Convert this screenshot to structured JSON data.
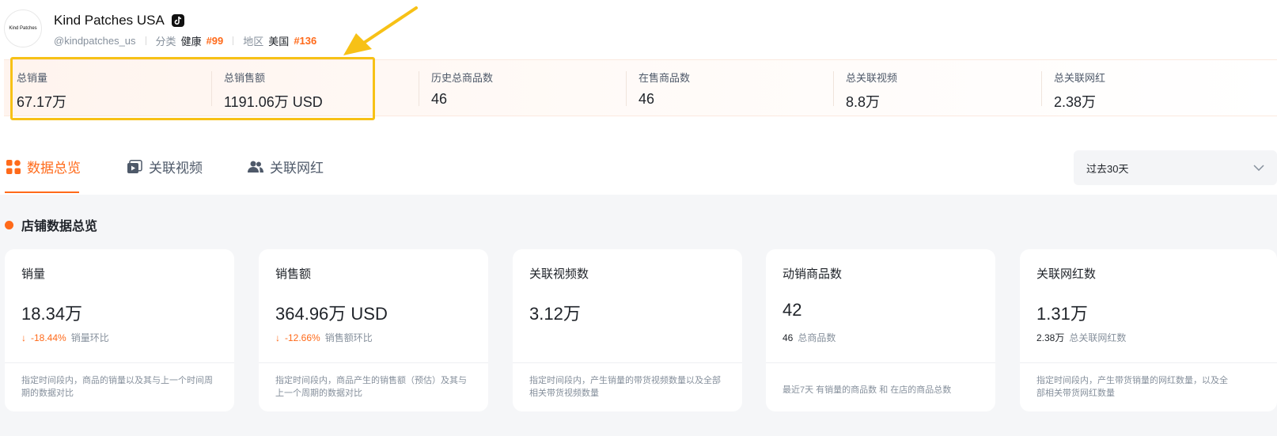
{
  "shop": {
    "logo_text": "Kind Patches",
    "name": "Kind Patches USA",
    "handle": "@kindpatches_us",
    "category_key": "分类",
    "category_value": "健康",
    "category_rank": "#99",
    "region_key": "地区",
    "region_value": "美国",
    "region_rank": "#136"
  },
  "stats": [
    {
      "label": "总销量",
      "value": "67.17万"
    },
    {
      "label": "总销售额",
      "value": "1191.06万 USD"
    },
    {
      "label": "历史总商品数",
      "value": "46"
    },
    {
      "label": "在售商品数",
      "value": "46"
    },
    {
      "label": "总关联视频",
      "value": "8.8万"
    },
    {
      "label": "总关联网红",
      "value": "2.38万"
    }
  ],
  "tabs": [
    {
      "label": "数据总览",
      "icon": "grid-icon"
    },
    {
      "label": "关联视频",
      "icon": "video-icon"
    },
    {
      "label": "关联网红",
      "icon": "users-icon"
    }
  ],
  "period_select": {
    "value": "过去30天"
  },
  "overview": {
    "title": "店铺数据总览",
    "cards": [
      {
        "title": "销量",
        "value": "18.34万",
        "change": "-18.44%",
        "change_label": "销量环比",
        "desc": "指定时间段内，商品的销量以及其与上一个时间周期的数据对比"
      },
      {
        "title": "销售额",
        "value": "364.96万 USD",
        "change": "-12.66%",
        "change_label": "销售额环比",
        "desc": "指定时间段内，商品产生的销售额（预估）及其与上一个周期的数据对比"
      },
      {
        "title": "关联视频数",
        "value": "3.12万",
        "desc": "指定时间段内，产生销量的带货视频数量以及全部相关带货视频数量"
      },
      {
        "title": "动销商品数",
        "value": "42",
        "sub_value": "46",
        "sub_label": "总商品数",
        "desc": "最近7天 有销量的商品数 和 在店的商品总数"
      },
      {
        "title": "关联网红数",
        "value": "1.31万",
        "sub_value": "2.38万",
        "sub_label": "总关联网红数",
        "desc": "指定时间段内，产生带货销量的网红数量，以及全部相关带货网红数量"
      }
    ]
  },
  "colors": {
    "accent": "#ff6a1a",
    "highlight": "#f7c116"
  }
}
